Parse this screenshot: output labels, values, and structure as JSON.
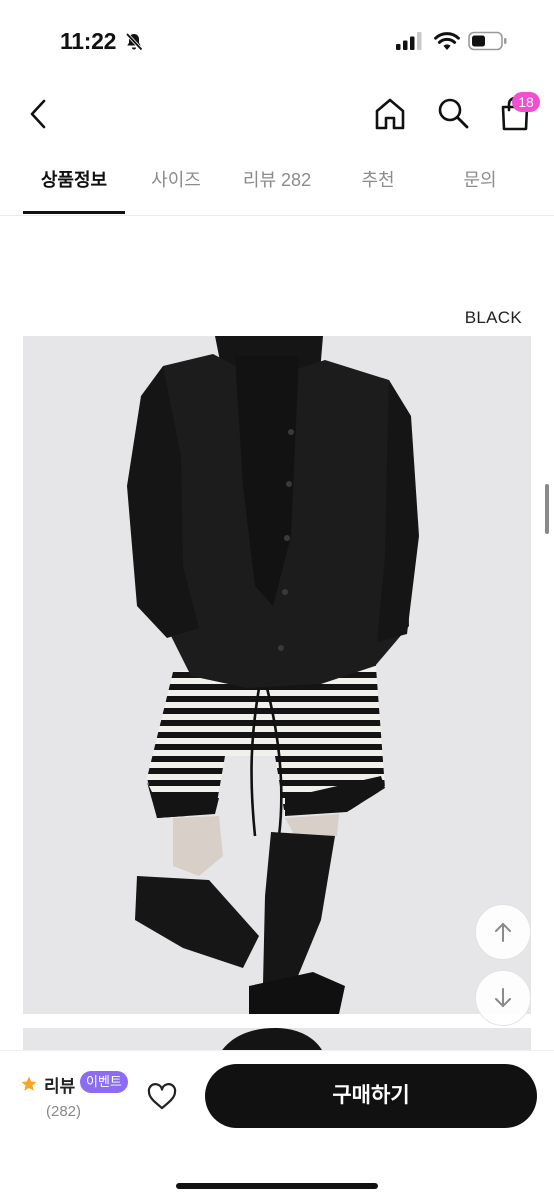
{
  "status_bar": {
    "time": "11:22",
    "bell_icon": "bell-slash-icon",
    "signal_icon": "cellular-signal-icon",
    "wifi_icon": "wifi-icon",
    "battery_icon": "battery-icon"
  },
  "nav": {
    "back_icon": "chevron-left-icon",
    "home_icon": "home-icon",
    "search_icon": "search-icon",
    "cart_icon": "shopping-bag-icon",
    "cart_count": "18",
    "badge_color": "#f14fd2"
  },
  "tabs": [
    {
      "label": "상품정보",
      "active": true
    },
    {
      "label": "사이즈",
      "active": false
    },
    {
      "label": "리뷰 282",
      "active": false
    },
    {
      "label": "추천",
      "active": false
    },
    {
      "label": "문의",
      "active": false
    }
  ],
  "product": {
    "color_label": "BLACK"
  },
  "floating": {
    "up_icon": "arrow-up-icon",
    "down_icon": "arrow-down-icon"
  },
  "bottom_bar": {
    "star_icon": "star-icon",
    "star_color": "#f5a623",
    "review_label": "리뷰",
    "event_badge": "이벤트",
    "event_color": "#8b6cf2",
    "review_count": "(282)",
    "like_icon": "heart-outline-icon",
    "buy_label": "구매하기"
  }
}
